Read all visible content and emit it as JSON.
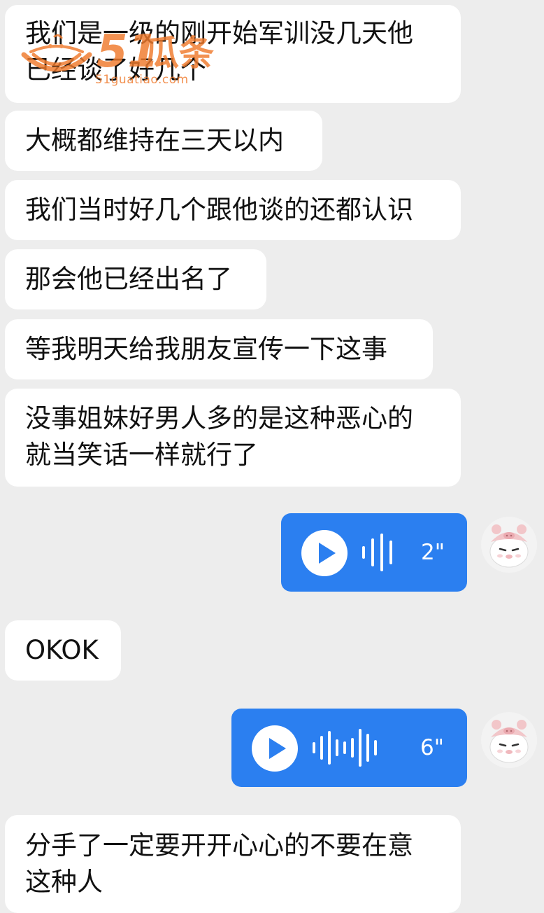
{
  "messages": [
    {
      "lines": [
        "我们是一级的刚开始军训没几天他",
        "已经谈了好几个"
      ]
    },
    {
      "lines": [
        "大概都维持在三天以内"
      ]
    },
    {
      "lines": [
        "我们当时好几个跟他谈的还都认识"
      ]
    },
    {
      "lines": [
        "那会他已经出名了"
      ]
    },
    {
      "lines": [
        "等我明天给我朋友宣传一下这事"
      ]
    },
    {
      "lines": [
        "没事姐妹好男人多的是这种恶心的",
        "就当笑话一样就行了"
      ]
    },
    {
      "lines": [
        "OKOK"
      ]
    },
    {
      "lines": [
        "分手了一定要开开心心的不要在意",
        "这种人"
      ]
    }
  ],
  "voice_messages": [
    {
      "duration": "2\""
    },
    {
      "duration": "6\""
    }
  ],
  "watermark": {
    "digits": "51",
    "name": "瓜条",
    "url": "51guatiao.com"
  },
  "colors": {
    "background": "#ededed",
    "bubble_received": "#ffffff",
    "bubble_voice": "#2b7ff0",
    "watermark": "#f07a2c"
  },
  "icons": {
    "play": "play-icon",
    "waveform": "voice-waveform-icon",
    "avatar": "pig-hat-cat-avatar"
  }
}
